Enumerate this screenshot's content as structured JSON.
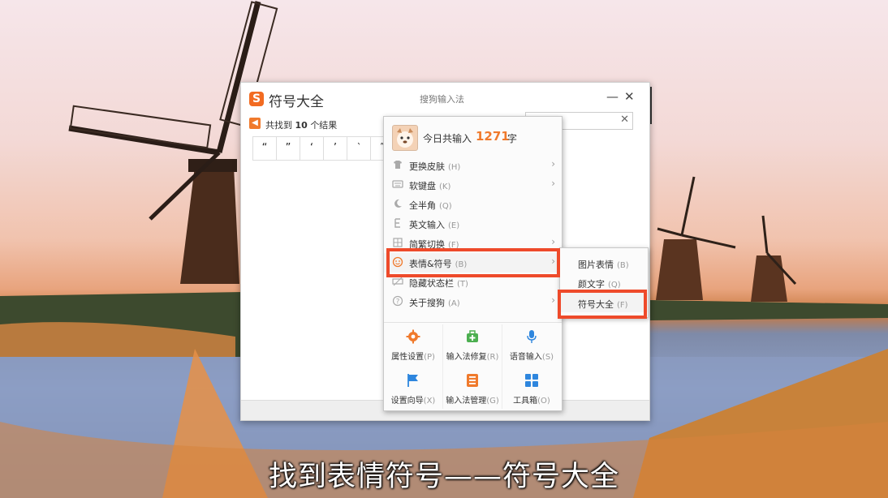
{
  "symbol_window": {
    "title": "符号大全",
    "header_center": "搜狗输入法",
    "minimize_label": "—",
    "close_label": "✕",
    "search_clear": "✕",
    "back_arrow": "◀",
    "result_prefix": "共找到",
    "result_count": "10",
    "result_suffix": "个结果",
    "symbols": [
      "“",
      "”",
      "‘",
      "’",
      "‵",
      "″"
    ]
  },
  "menu": {
    "today_label": "今日共输入",
    "today_count": "1271",
    "today_unit": "字",
    "items": [
      {
        "label": "更换皮肤",
        "key": "(H)",
        "icon": "shirt-icon",
        "arrow": "›"
      },
      {
        "label": "软键盘",
        "key": "(K)",
        "icon": "keyboard-icon",
        "arrow": "›"
      },
      {
        "label": "全半角",
        "key": "(Q)",
        "icon": "moon-icon",
        "arrow": ""
      },
      {
        "label": "英文输入",
        "key": "(E)",
        "icon": "english-icon",
        "arrow": ""
      },
      {
        "label": "简繁切换",
        "key": "(F)",
        "icon": "traditional-icon",
        "arrow": "›"
      },
      {
        "label": "表情&符号",
        "key": "(B)",
        "icon": "smiley-icon",
        "arrow": "›"
      },
      {
        "label": "隐藏状态栏",
        "key": "(T)",
        "icon": "hide-icon",
        "arrow": ""
      },
      {
        "label": "关于搜狗",
        "key": "(A)",
        "icon": "question-icon",
        "arrow": "›"
      }
    ],
    "grid": [
      {
        "label": "属性设置",
        "key": "(P)",
        "icon": "gear-icon"
      },
      {
        "label": "输入法修复",
        "key": "(R)",
        "icon": "repair-kit-icon"
      },
      {
        "label": "语音输入",
        "key": "(S)",
        "icon": "microphone-icon"
      },
      {
        "label": "设置向导",
        "key": "(X)",
        "icon": "flag-icon"
      },
      {
        "label": "输入法管理",
        "key": "(G)",
        "icon": "list-icon"
      },
      {
        "label": "工具箱",
        "key": "(O)",
        "icon": "toolbox-icon"
      }
    ]
  },
  "submenu": {
    "items": [
      {
        "label": "图片表情",
        "key": "(B)"
      },
      {
        "label": "颜文字",
        "key": "(Q)"
      },
      {
        "label": "符号大全",
        "key": "(F)"
      }
    ]
  },
  "caption": "找到表情符号——符号大全",
  "colors": {
    "accent": "#f07a2c",
    "highlight": "#ee4a2a"
  }
}
